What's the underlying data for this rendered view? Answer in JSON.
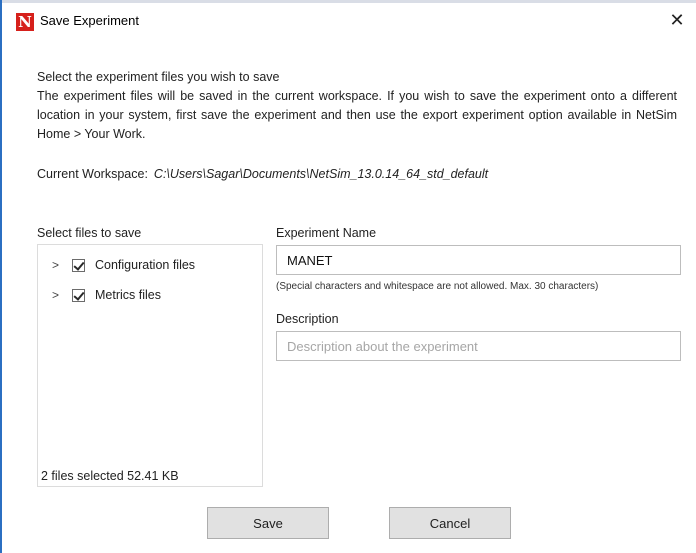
{
  "window": {
    "title": "Save Experiment",
    "app_icon_letter": "N",
    "close_glyph": "✕"
  },
  "intro": {
    "line1": "Select the experiment files you wish to save",
    "line2": "The experiment files will be saved in the current workspace. If you wish to save the experiment onto a different location in your system, first save the experiment and then use the export experiment option available in NetSim Home > Your Work."
  },
  "workspace": {
    "label": "Current Workspace:",
    "path": "C:\\Users\\Sagar\\Documents\\NetSim_13.0.14_64_std_default"
  },
  "files": {
    "label": "Select files to save",
    "items": [
      {
        "label": "Configuration files",
        "checked": true
      },
      {
        "label": "Metrics files",
        "checked": true
      }
    ],
    "summary": "2 files selected 52.41 KB"
  },
  "experiment_name": {
    "label": "Experiment Name",
    "value": "MANET",
    "hint": "(Special characters and whitespace are not allowed. Max. 30 characters)"
  },
  "description": {
    "label": "Description",
    "value": "",
    "placeholder": "Description about the experiment"
  },
  "buttons": {
    "save": "Save",
    "cancel": "Cancel"
  },
  "colors": {
    "accent_border": "#2b6fc2",
    "app_icon": "#d6201b",
    "button_bg": "#e1e1e1"
  }
}
